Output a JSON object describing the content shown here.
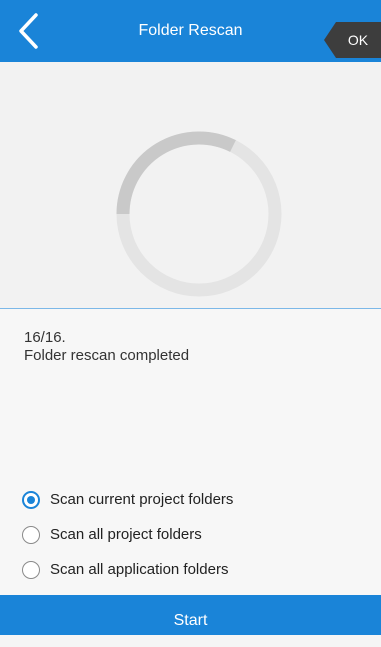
{
  "header": {
    "title": "Folder Rescan",
    "back_icon": "chevron-left-icon",
    "ok_label": "OK"
  },
  "status": {
    "count": "16/16.",
    "message": "Folder rescan completed"
  },
  "scan_options": [
    {
      "label": "Scan current project folders",
      "selected": true
    },
    {
      "label": "Scan all project folders",
      "selected": false
    },
    {
      "label": "Scan all application folders",
      "selected": false
    }
  ],
  "start_button": {
    "label": "Start"
  },
  "colors": {
    "accent": "#1a84d8",
    "ring_track": "#e4e4e4",
    "ring_arc": "#c9c9c9"
  }
}
